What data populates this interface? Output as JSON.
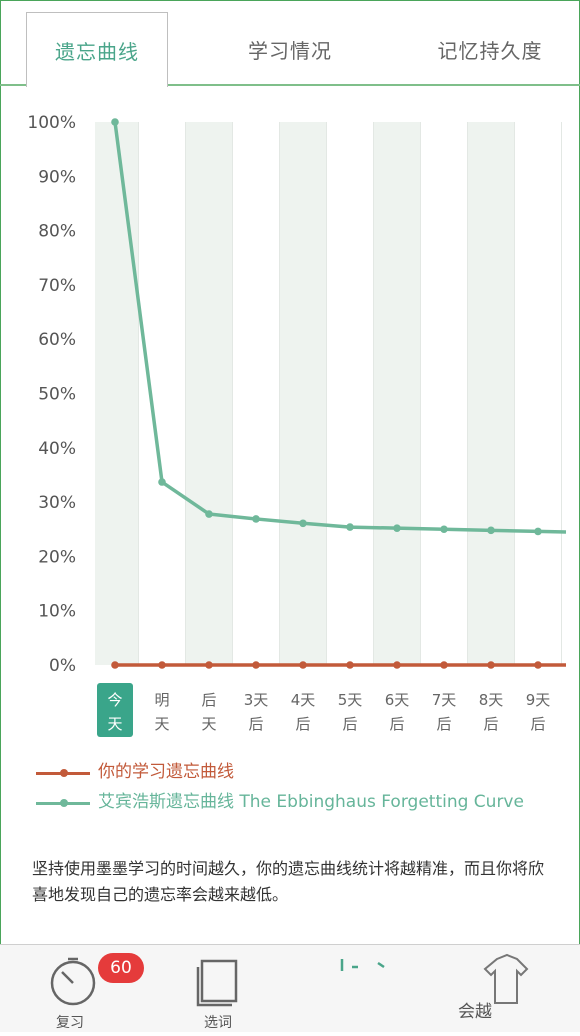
{
  "tabs": [
    {
      "label": "遗忘曲线",
      "active": true
    },
    {
      "label": "学习情况",
      "active": false
    },
    {
      "label": "记忆持久度",
      "active": false
    }
  ],
  "chart_data": {
    "type": "line",
    "categories": [
      [
        "今",
        "天"
      ],
      [
        "明",
        "天"
      ],
      [
        "后",
        "天"
      ],
      [
        "3天",
        "后"
      ],
      [
        "4天",
        "后"
      ],
      [
        "5天",
        "后"
      ],
      [
        "6天",
        "后"
      ],
      [
        "7天",
        "后"
      ],
      [
        "8天",
        "后"
      ],
      [
        "9天",
        "后"
      ]
    ],
    "y_ticks": [
      "100%",
      "90%",
      "80%",
      "70%",
      "60%",
      "50%",
      "40%",
      "30%",
      "20%",
      "10%",
      "0%"
    ],
    "ylim": [
      0,
      100
    ],
    "grid": "vertical alternating bands",
    "series": [
      {
        "name": "你的学习遗忘曲线",
        "color": "#c25a3a",
        "values": [
          0,
          0,
          0,
          0,
          0,
          0,
          0,
          0,
          0,
          0,
          0
        ]
      },
      {
        "name": "艾宾浩斯遗忘曲线 The Ebbinghaus Forgetting Curve",
        "color": "#6fb89a",
        "values": [
          100,
          33.7,
          27.8,
          26.9,
          26.1,
          25.4,
          25.2,
          25.0,
          24.8,
          24.6,
          24.5
        ]
      }
    ]
  },
  "legend": [
    {
      "label": "你的学习遗忘曲线",
      "color": "#c25a3a"
    },
    {
      "label": "艾宾浩斯遗忘曲线 The Ebbinghaus Forgetting Curve",
      "color": "#6fb89a"
    }
  ],
  "note": "坚持使用墨墨学习的时间越久，你的遗忘曲线统计将越精准，而且你将欣喜地发现自己的遗忘率会越来越低。",
  "colors": {
    "accent": "#4aa58a",
    "today_badge": "#3aa58a",
    "band": "#eef3ef"
  },
  "bottom_nav": [
    {
      "label": "复习",
      "icon": "stopwatch-icon",
      "badge": "60"
    },
    {
      "label": "选词",
      "icon": "cards-icon"
    },
    {
      "label": "",
      "icon": "chart-icon"
    },
    {
      "label": "会越",
      "icon": "shirt-icon"
    }
  ]
}
